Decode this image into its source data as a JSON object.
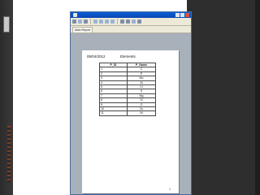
{
  "tab": {
    "label": "Main Report"
  },
  "document": {
    "date": "05/04/2012",
    "title": "Elements",
    "columns": [
      "P_ID",
      "P_Name"
    ],
    "rows": [
      [
        "1",
        "C"
      ],
      [
        "2",
        "P"
      ],
      [
        "3",
        "Mn"
      ],
      [
        "4",
        "Al"
      ],
      [
        "5",
        "Cl"
      ],
      [
        "6",
        "S"
      ],
      [
        "7",
        "Mg"
      ],
      [
        "8",
        "Si"
      ],
      [
        "9",
        "O"
      ],
      [
        "10",
        "Cu"
      ],
      [
        "11",
        "Ni"
      ]
    ],
    "page_number": "1"
  },
  "colors": {
    "titlebar": "#0b46b0",
    "window_bg": "#a8b0b9",
    "slide_side": "#2e2e2e",
    "accent": "#8a3a1f"
  }
}
